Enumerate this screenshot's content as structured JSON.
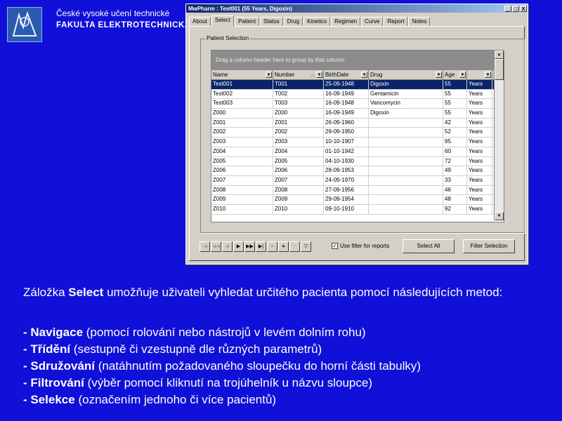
{
  "header": {
    "institution_line1": "České vysoké učení technické",
    "institution_line2": "FAKULTA ELEKTROTECHNICKÁ"
  },
  "window": {
    "title": "MwPharm : Test001 (55 Years, Digoxin)",
    "minimize": "_",
    "maximize": "□",
    "close": "X",
    "tabs": [
      "About",
      "Select",
      "Patient",
      "Status",
      "Drug",
      "Kinetics",
      "Regimen",
      "Curve",
      "Report",
      "Notes"
    ],
    "active_tab": "Select",
    "group_title": "Patient Selection",
    "group_area_hint": "Drag a column header here to group by that column",
    "columns": [
      "Name",
      "Number",
      "BirthDate",
      "Drug",
      "Age",
      ""
    ],
    "rows": [
      [
        "Test001",
        "T001",
        "25-09-1948",
        "Digoxin",
        "55",
        "Years"
      ],
      [
        "Test002",
        "T002",
        "16-09-1949",
        "Gentamicin",
        "55",
        "Years"
      ],
      [
        "Test003",
        "T003",
        "16-09-1948",
        "Vancomycin",
        "55",
        "Years"
      ],
      [
        "Z000",
        "Z000",
        "16-09-1949",
        "Digoxin",
        "55",
        "Years"
      ],
      [
        "Z001",
        "Z001",
        "26-09-1960",
        "",
        "42",
        "Years"
      ],
      [
        "Z002",
        "Z002",
        "29-09-1950",
        "",
        "52",
        "Years"
      ],
      [
        "Z003",
        "Z003",
        "10-10-1907",
        "",
        "95",
        "Years"
      ],
      [
        "Z004",
        "Z004",
        "01-10-1942",
        "",
        "60",
        "Years"
      ],
      [
        "Z005",
        "Z005",
        "04-10-1930",
        "",
        "72",
        "Years"
      ],
      [
        "Z006",
        "Z006",
        "28-09-1953",
        "",
        "49",
        "Years"
      ],
      [
        "Z007",
        "Z007",
        "24-09-1970",
        "",
        "33",
        "Years"
      ],
      [
        "Z008",
        "Z008",
        "27-09-1956",
        "",
        "46",
        "Years"
      ],
      [
        "Z009",
        "Z009",
        "29-09-1954",
        "",
        "48",
        "Years"
      ],
      [
        "Z010",
        "Z010",
        "09-10-1910",
        "",
        "92",
        "Years"
      ]
    ],
    "nav_buttons": [
      "|◀",
      "◀◀",
      "◀",
      "▶",
      "▶▶",
      "▶|",
      "–",
      "∗",
      "*",
      "▽"
    ],
    "use_filter_label": "Use filter for reports",
    "use_filter_checked": "✓",
    "select_all_label": "Select All",
    "filter_selection_label": "Filter Selection"
  },
  "text": {
    "intro_prefix": "Záložka ",
    "intro_bold": "Select",
    "intro_suffix": " umožňuje uživateli vyhledat určitého pacienta pomocí následujících metod:",
    "items": [
      {
        "bold": "- Navigace",
        "rest": " (pomocí rolování nebo nástrojů v levém dolním rohu)"
      },
      {
        "bold": "- Třídění",
        "rest": " (sestupně či vzestupně dle různých parametrů)"
      },
      {
        "bold": "- Sdružování",
        "rest": " (natáhnutím požadovaného sloupečku do horní části tabulky)"
      },
      {
        "bold": "- Filtrování",
        "rest": " (výběr pomocí kliknutí na trojúhelník u názvu sloupce)"
      },
      {
        "bold": "- Selekce",
        "rest": " (označením jednoho či více pacientů)"
      }
    ]
  }
}
